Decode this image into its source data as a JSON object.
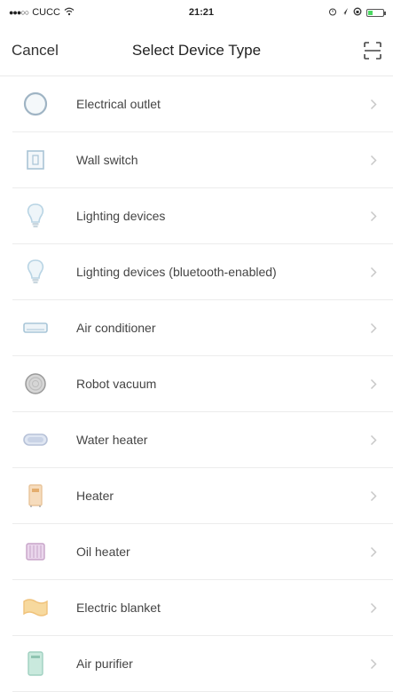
{
  "status_bar": {
    "carrier": "CUCC",
    "time": "21:21",
    "battery_level": 0.3
  },
  "nav": {
    "cancel_label": "Cancel",
    "title": "Select Device Type",
    "scan_icon": "scan-icon"
  },
  "devices": [
    {
      "label": "Electrical outlet",
      "icon": "outlet-icon",
      "color": "#9fb4c4"
    },
    {
      "label": "Wall switch",
      "icon": "wall-switch-icon",
      "color": "#a9c4d6"
    },
    {
      "label": "Lighting devices",
      "icon": "bulb-icon",
      "color": "#b8d4e4"
    },
    {
      "label": "Lighting devices (bluetooth-enabled)",
      "icon": "bluetooth-bulb-icon",
      "color": "#b8d4e4"
    },
    {
      "label": "Air conditioner",
      "icon": "air-conditioner-icon",
      "color": "#a9c6d8"
    },
    {
      "label": "Robot vacuum",
      "icon": "robot-vacuum-icon",
      "color": "#9a9a9a"
    },
    {
      "label": "Water heater",
      "icon": "water-heater-icon",
      "color": "#b7c2d8"
    },
    {
      "label": "Heater",
      "icon": "heater-icon",
      "color": "#e8c49a"
    },
    {
      "label": "Oil heater",
      "icon": "oil-heater-icon",
      "color": "#c7a4c8"
    },
    {
      "label": "Electric blanket",
      "icon": "electric-blanket-icon",
      "color": "#f0c27a"
    },
    {
      "label": "Air purifier",
      "icon": "air-purifier-icon",
      "color": "#9fd0c0"
    }
  ]
}
